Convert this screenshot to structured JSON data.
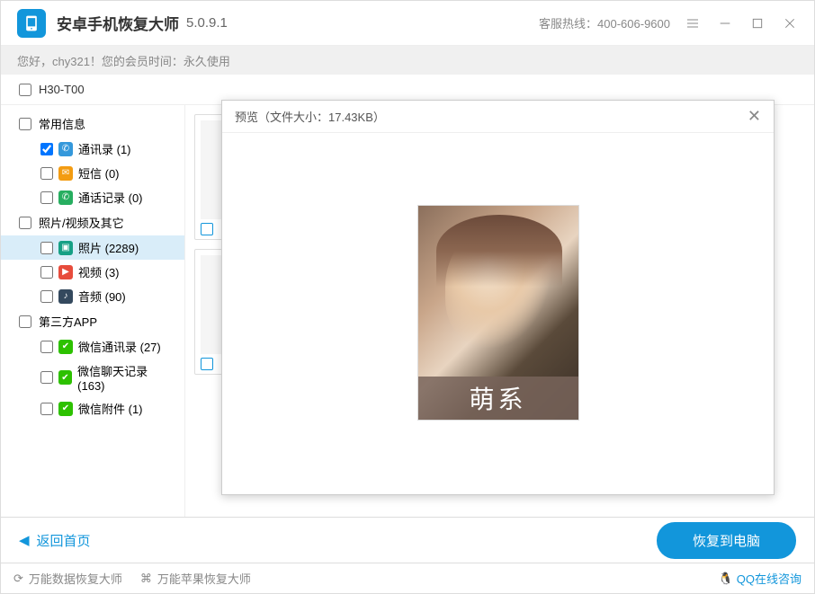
{
  "titlebar": {
    "app_name": "安卓手机恢复大师",
    "version": "5.0.9.1",
    "hotline": "客服热线：400-606-9600"
  },
  "welcome": {
    "text": "您好，chy321！您的会员时间：永久使用"
  },
  "device": {
    "name": "H30-T00"
  },
  "sidebar": {
    "cat1": "常用信息",
    "cat1_items": [
      {
        "label": "通讯录 (1)",
        "checked": true
      },
      {
        "label": "短信 (0)",
        "checked": false
      },
      {
        "label": "通话记录 (0)",
        "checked": false
      }
    ],
    "cat2": "照片/视频及其它",
    "cat2_items": [
      {
        "label": "照片 (2289)",
        "checked": false,
        "selected": true
      },
      {
        "label": "视频 (3)",
        "checked": false
      },
      {
        "label": "音频 (90)",
        "checked": false
      }
    ],
    "cat3": "第三方APP",
    "cat3_items": [
      {
        "label": "微信通讯录 (27)",
        "checked": false
      },
      {
        "label": "微信聊天记录 (163)",
        "checked": false
      },
      {
        "label": "微信附件 (1)",
        "checked": false
      }
    ]
  },
  "modal": {
    "title": "预览（文件大小：17.43KB）",
    "caption": "萌系"
  },
  "bottom": {
    "back": "返回首页",
    "recover": "恢复到电脑"
  },
  "footer": {
    "link1": "万能数据恢复大师",
    "link2": "万能苹果恢复大师",
    "qq": "QQ在线咨询"
  }
}
